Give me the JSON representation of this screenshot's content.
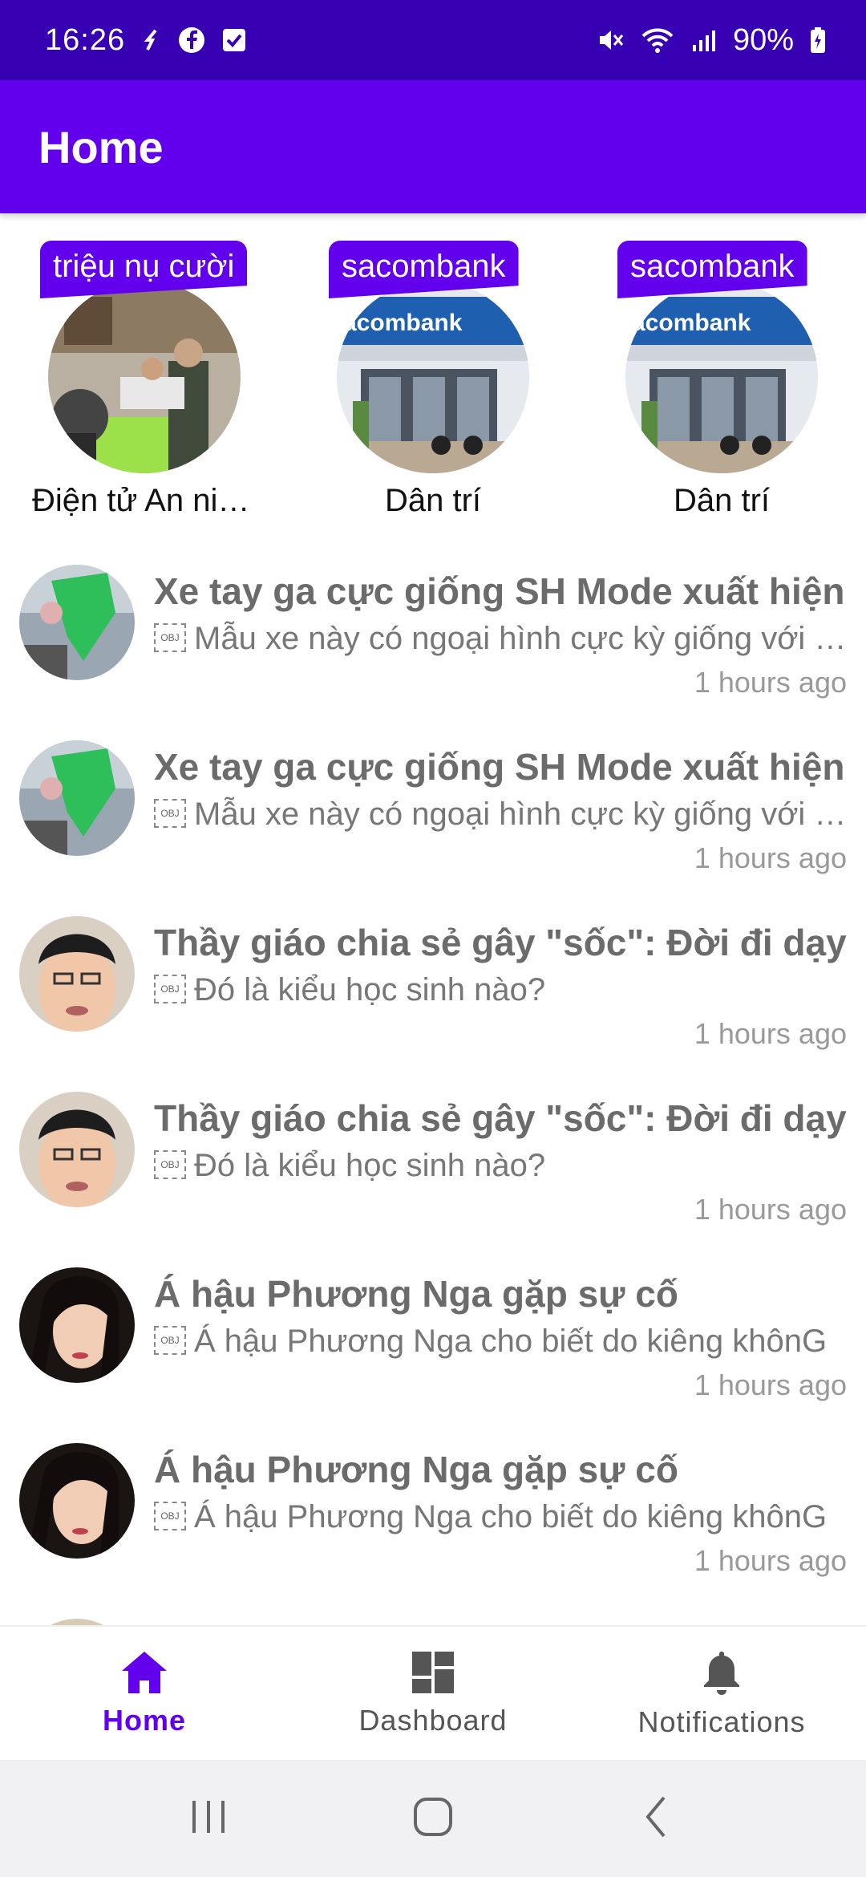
{
  "status_bar": {
    "time": "16:26",
    "battery": "90%",
    "icons": [
      "sync-icon",
      "facebook-icon",
      "checkbox-icon",
      "mute-icon",
      "wifi-icon",
      "signal-icon",
      "battery-icon"
    ]
  },
  "app_bar": {
    "title": "Home"
  },
  "stories": [
    {
      "tag": "triệu nụ cười",
      "name": "Điện tử An ninh Thủ đô"
    },
    {
      "tag": "sacombank",
      "name": "Dân trí"
    },
    {
      "tag": "sacombank",
      "name": "Dân trí"
    }
  ],
  "news": [
    {
      "title": "Xe tay ga cực giống SH Mode xuất hiện",
      "desc": "Mẫu xe này có ngoại hình cực kỳ giống với Honda SH Mode",
      "time": "1 hours ago"
    },
    {
      "title": "Xe tay ga cực giống SH Mode xuất hiện",
      "desc": "Mẫu xe này có ngoại hình cực kỳ giống với Honda SH Mode",
      "time": "1 hours ago"
    },
    {
      "title": "Thầy giáo chia sẻ gây \"sốc\": Đời đi dạy",
      "desc": "Đó là kiểu học sinh nào?",
      "time": "1 hours ago"
    },
    {
      "title": "Thầy giáo chia sẻ gây \"sốc\": Đời đi dạy",
      "desc": "Đó là kiểu học sinh nào?",
      "time": "1 hours ago"
    },
    {
      "title": "Á hậu Phương Nga gặp sự cố",
      "desc": "Á hậu Phương Nga cho biết do kiêng khônG",
      "time": "1 hours ago"
    },
    {
      "title": "Á hậu Phương Nga gặp sự cố",
      "desc": "Á hậu Phương Nga cho biết do kiêng khônG",
      "time": "1 hours ago"
    }
  ],
  "obj_placeholder": "OBJ",
  "bottom_nav": {
    "home": "Home",
    "dashboard": "Dashboard",
    "notifications": "Notifications"
  },
  "colors": {
    "status_bar": "#3700B3",
    "app_bar": "#6200EE",
    "accent": "#6200EE"
  }
}
